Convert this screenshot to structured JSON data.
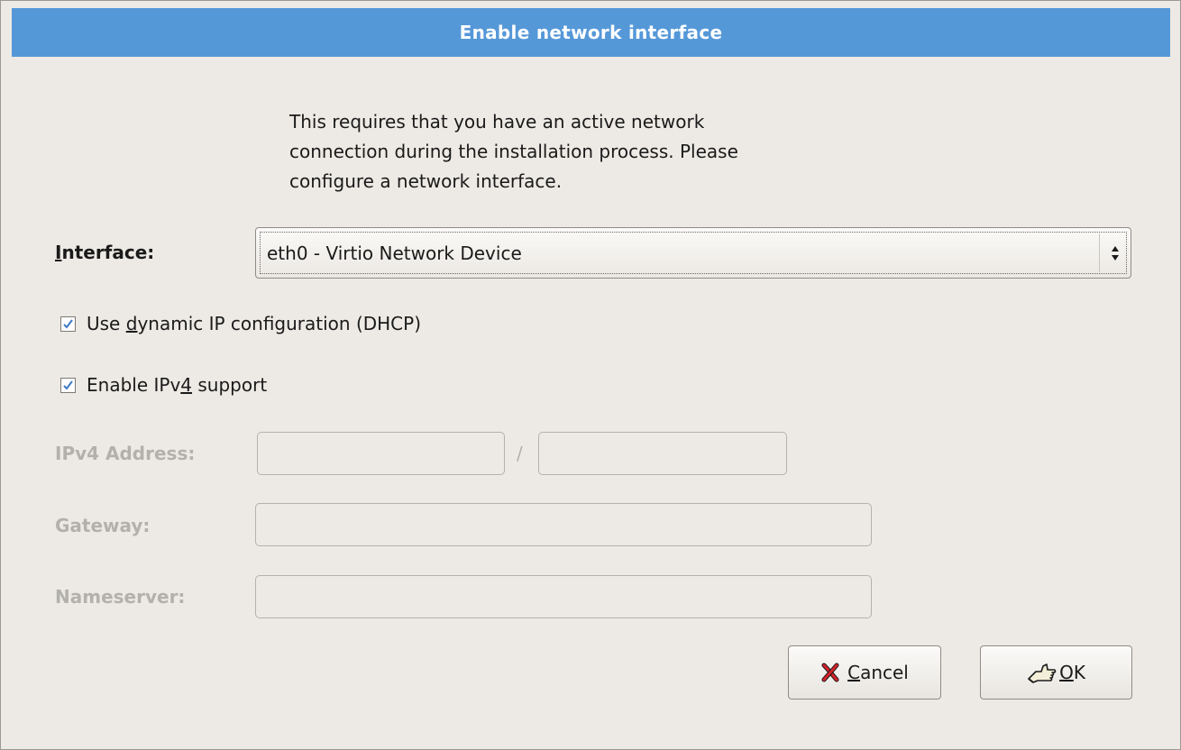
{
  "dialog": {
    "title": "Enable network interface",
    "intro_lines": [
      "This requires that you have an active network",
      "connection during the installation process.  Please",
      "configure a network interface."
    ]
  },
  "interface": {
    "label_mnemonic": "I",
    "label_rest": "nterface:",
    "selected": "eth0 - Virtio Network Device"
  },
  "options": {
    "dhcp": {
      "checked": true,
      "label_before": "Use ",
      "label_mnemonic": "d",
      "label_after": "ynamic IP configuration (DHCP)"
    },
    "ipv4": {
      "checked": true,
      "label_before": "Enable IPv",
      "label_mnemonic": "4",
      "label_after": " support"
    }
  },
  "fields": {
    "ipv4_address_label": "IPv4 Address:",
    "ipv4_address_value": "",
    "prefix_separator": "/",
    "prefix_value": "",
    "gateway_label": "Gateway:",
    "gateway_value": "",
    "nameserver_label": "Nameserver:",
    "nameserver_value": ""
  },
  "buttons": {
    "cancel_mnemonic": "C",
    "cancel_rest": "ancel",
    "cancel_icon": "red-x-icon",
    "ok_mnemonic": "O",
    "ok_rest": "K",
    "ok_icon": "hand-pointing-icon"
  },
  "colors": {
    "titlebar": "#5598d8",
    "background": "#edeae5",
    "disabled_text": "#b3b1ad"
  }
}
